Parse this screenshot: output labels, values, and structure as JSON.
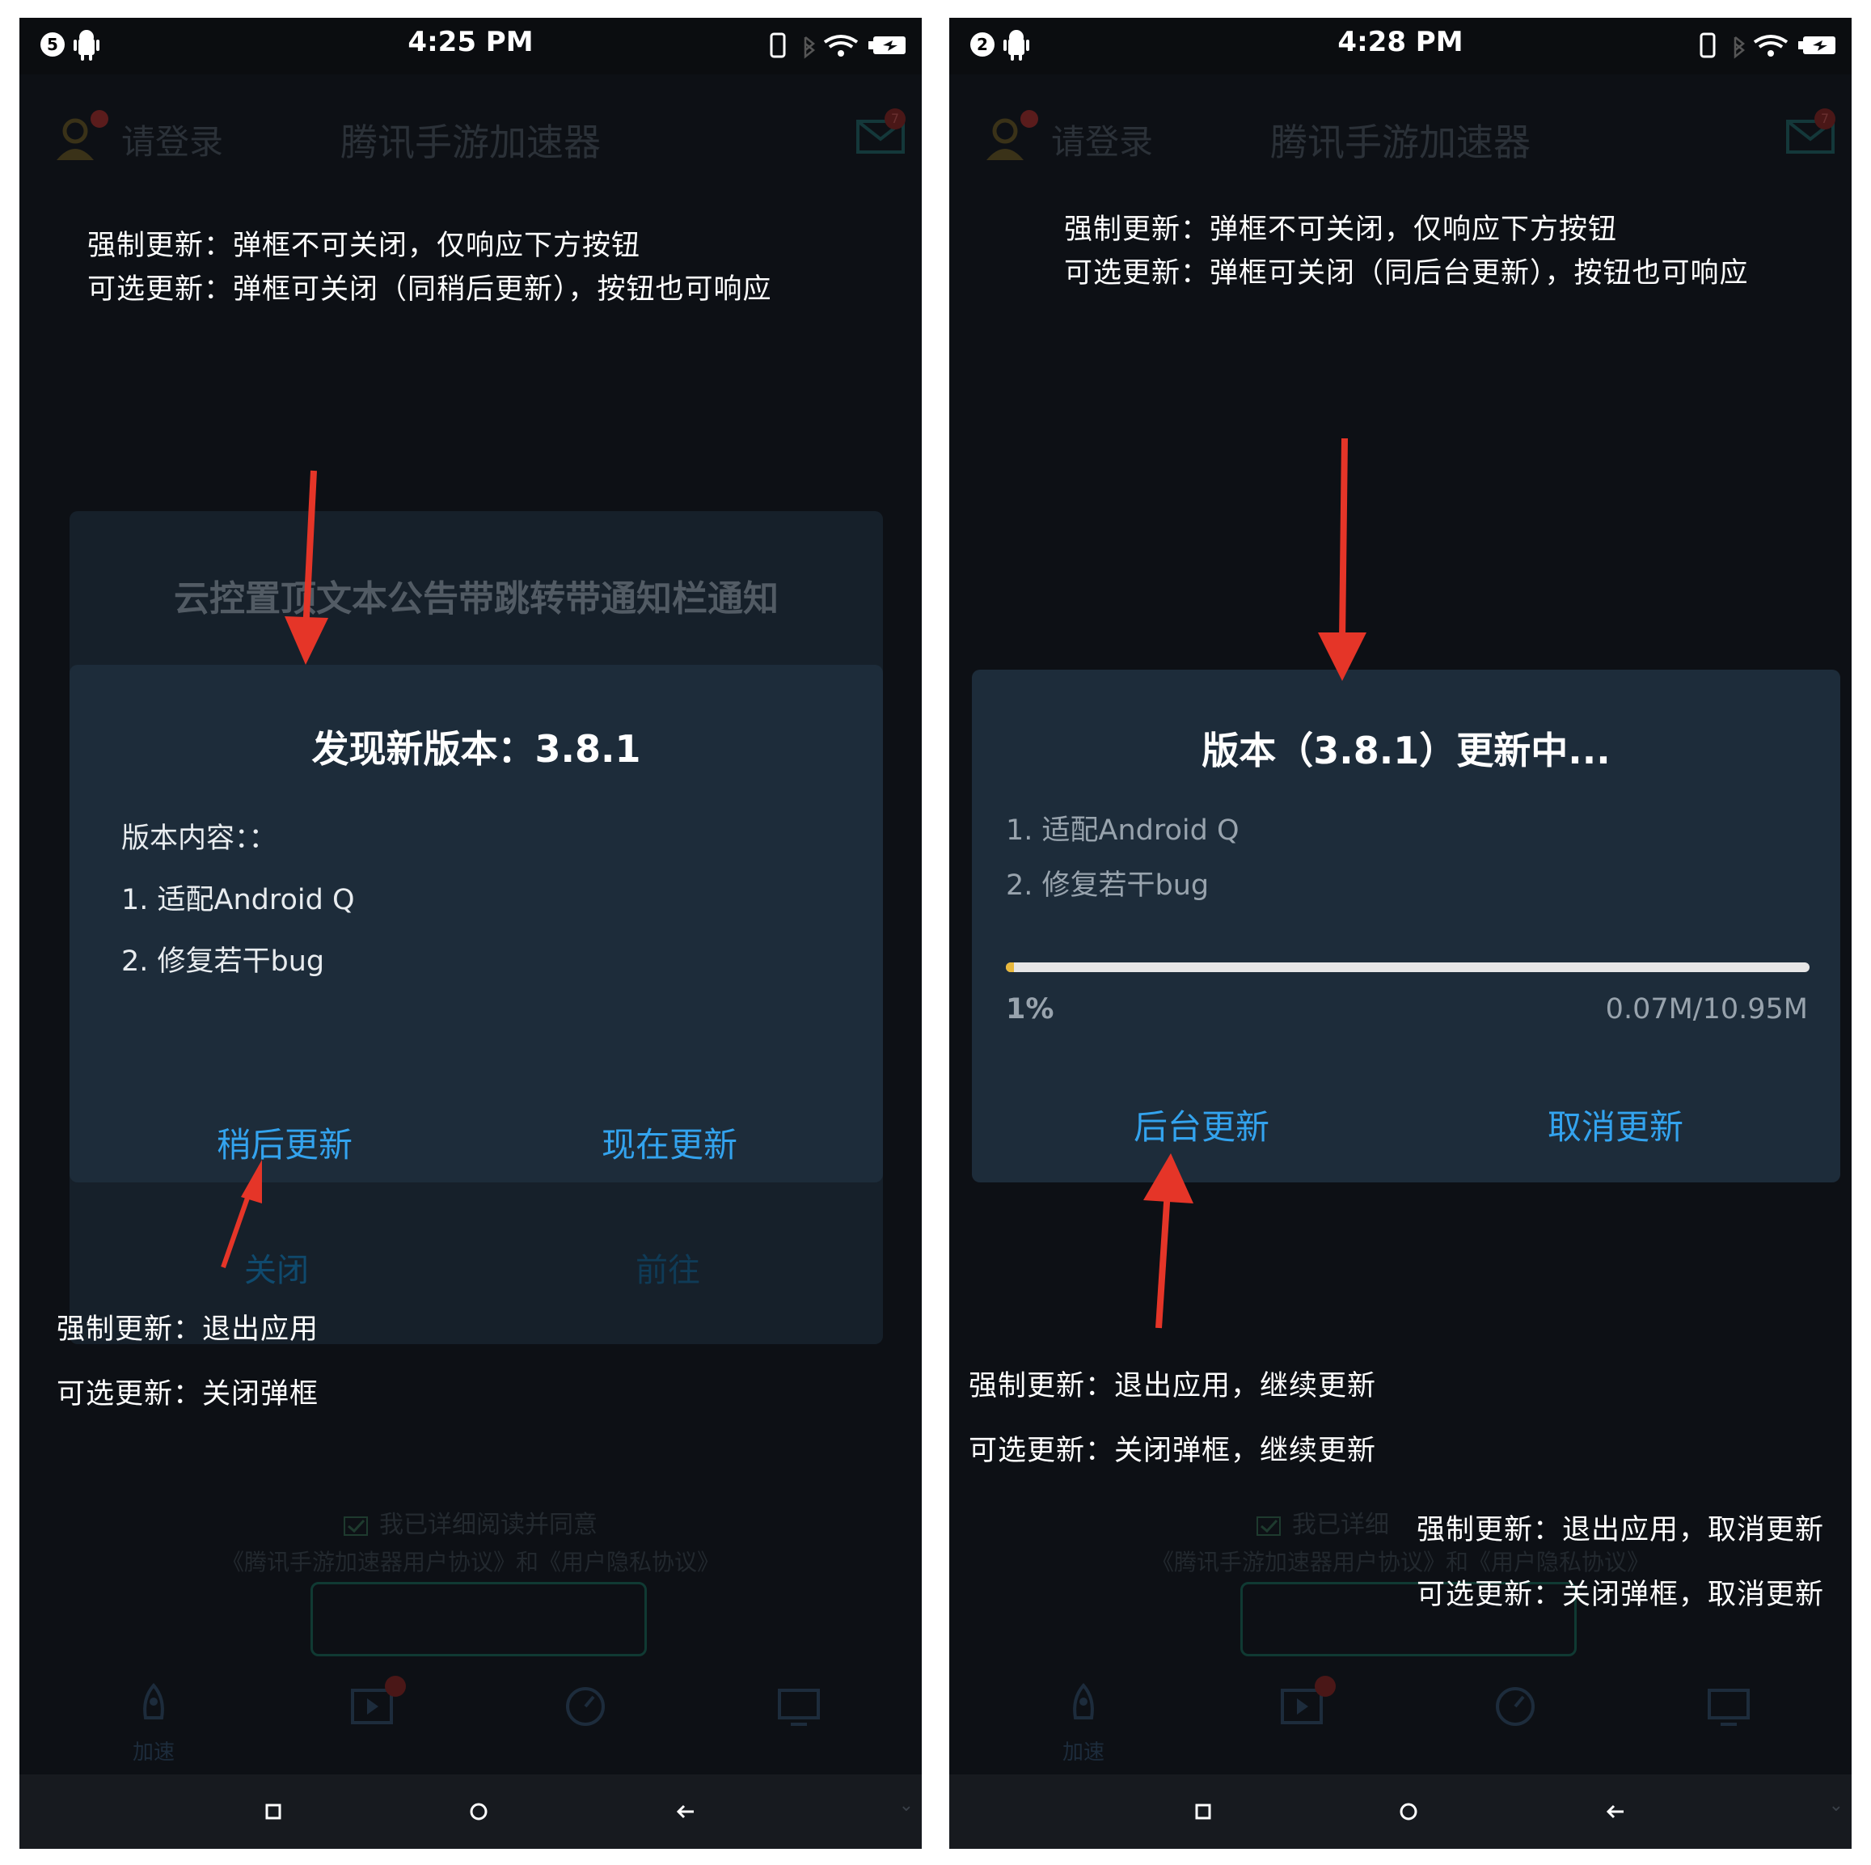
{
  "left": {
    "status": {
      "time": "4:25 PM",
      "notification_count": "5"
    },
    "appbar": {
      "login_text": "请登录",
      "title": "腾讯手游加速器",
      "mail_badge": "7"
    },
    "annotations": {
      "top_line1": "强制更新：弹框不可关闭，仅响应下方按钮",
      "top_line2": "可选更新：弹框可关闭（同稍后更新），按钮也可响应",
      "bottom_line1": "强制更新：退出应用",
      "bottom_line2": "可选更新：关闭弹框"
    },
    "notice": {
      "title": "云控置顶文本公告带跳转带通知栏通知",
      "close_label": "关闭",
      "go_label": "前往"
    },
    "dialog": {
      "title": "发现新版本：3.8.1",
      "content_heading": "版本内容：：",
      "items": [
        "1. 适配Android Q",
        "2. 修复若干bug"
      ],
      "later_button": "稍后更新",
      "now_button": "现在更新"
    },
    "agreement": {
      "checkbox_text": "我已详细阅读并同意",
      "links_text": "《腾讯手游加速器用户协议》和《用户隐私协议》"
    },
    "tabs": [
      {
        "label": "加速"
      },
      {
        "label": ""
      },
      {
        "label": ""
      },
      {
        "label": ""
      }
    ]
  },
  "right": {
    "status": {
      "time": "4:28 PM",
      "notification_count": "2"
    },
    "appbar": {
      "login_text": "请登录",
      "title": "腾讯手游加速器",
      "mail_badge": "7"
    },
    "annotations": {
      "top_line1": "强制更新：弹框不可关闭，仅响应下方按钮",
      "top_line2": "可选更新：弹框可关闭（同后台更新），按钮也可响应",
      "mid_line1": "强制更新：退出应用，继续更新",
      "mid_line2": "可选更新：关闭弹框，继续更新",
      "br_line1": "强制更新：退出应用，取消更新",
      "br_line2": "可选更新：关闭弹框，取消更新"
    },
    "dialog": {
      "title": "版本（3.8.1）更新中...",
      "items": [
        "1. 适配Android Q",
        "2. 修复若干bug"
      ],
      "progress_label": "1%",
      "progress_fraction": 0.01,
      "size_label": "0.07M/10.95M",
      "background_button": "后台更新",
      "cancel_button": "取消更新"
    },
    "agreement": {
      "checkbox_text": "我已详细",
      "links_text": "《腾讯手游加速器用户协议》和《用户隐私协议》"
    },
    "tabs": [
      {
        "label": "加速"
      },
      {
        "label": ""
      },
      {
        "label": ""
      },
      {
        "label": ""
      }
    ]
  },
  "colors": {
    "accent_button": "#33a3ee",
    "annotation_arrow": "#e53528",
    "progress_fill": "#e8b83c",
    "dialog_bg": "#1d2c3a"
  }
}
